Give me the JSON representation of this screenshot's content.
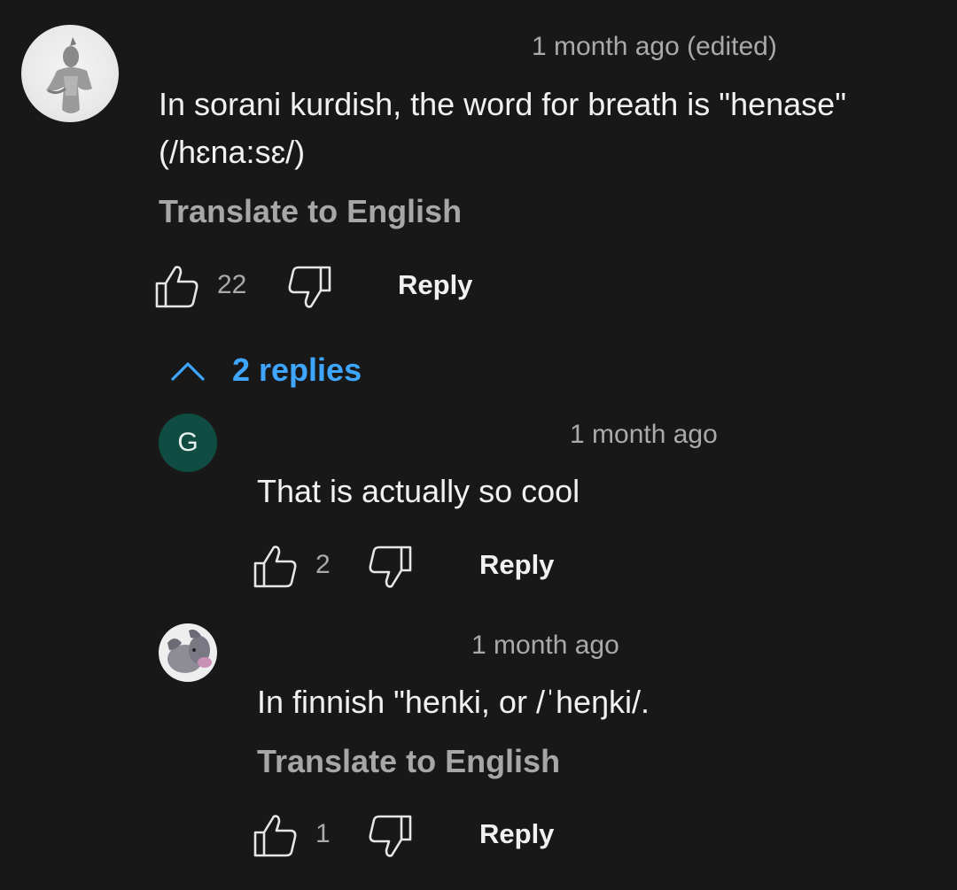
{
  "comment": {
    "timestamp": "1 month ago (edited)",
    "text_line1": "In sorani kurdish, the word for breath is \"henase\"",
    "text_line2": "(/hɛna:sɛ/)",
    "translate": "Translate to English",
    "likes": "22",
    "reply_label": "Reply",
    "replies_toggle": "2 replies"
  },
  "replies": [
    {
      "avatar_letter": "G",
      "timestamp": "1 month ago",
      "text": "That is actually so cool",
      "likes": "2",
      "reply_label": "Reply"
    },
    {
      "timestamp": "1 month ago",
      "text": "In finnish \"henki, or /ˈheŋki/.",
      "translate": "Translate to English",
      "likes": "1",
      "reply_label": "Reply"
    }
  ],
  "colors": {
    "background": "#181818",
    "link_blue": "#3ea6ff",
    "avatar_g": "#0f4d43"
  },
  "icons": [
    "thumbs-up-icon",
    "thumbs-down-icon",
    "chevron-up-icon"
  ]
}
